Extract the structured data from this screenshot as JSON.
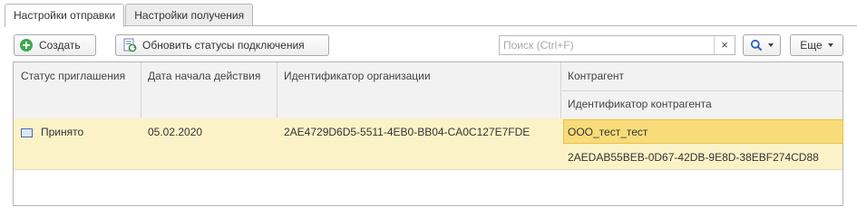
{
  "tabs": [
    {
      "label": "Настройки отправки",
      "active": true
    },
    {
      "label": "Настройки получения",
      "active": false
    }
  ],
  "toolbar": {
    "create_label": "Создать",
    "refresh_label": "Обновить статусы подключения",
    "search_placeholder": "Поиск (Ctrl+F)",
    "search_value": "",
    "clear_label": "×",
    "more_label": "Еще"
  },
  "table": {
    "columns": {
      "status": "Статус приглашения",
      "date": "Дата начала действия",
      "org_id": "Идентификатор организации",
      "counterparty": "Контрагент",
      "counterparty_id": "Идентификатор контрагента"
    },
    "rows": [
      {
        "status": "Принято",
        "date": "05.02.2020",
        "org_id": "2AE4729D6D5-5511-4EB0-BB04-CA0C127E7FDE",
        "counterparty": "ООО_тест_тест",
        "counterparty_id": "2AEDAB55BEB-0D67-42DB-9E8D-38EBF274CD88"
      }
    ]
  },
  "colors": {
    "row_highlight": "#fbf3c7",
    "selected_cell": "#f8dc7a",
    "create_icon": "#3da94b"
  }
}
